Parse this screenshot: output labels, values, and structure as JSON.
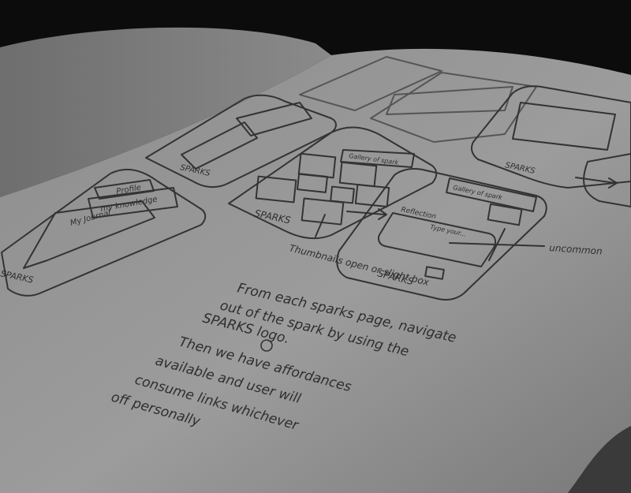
{
  "photo": {
    "subject": "sketchbook",
    "colors": {
      "background": "#0c0c0c",
      "page": "#9a9a9a",
      "left_page": "#8a8a8a",
      "ink": "#2e2e2e"
    }
  },
  "sketches": {
    "screen_left": {
      "header_1": "Profile",
      "header_2": "my knowledge",
      "box_label": "My Journal",
      "logo": "SPARKS"
    },
    "screen_middle": {
      "header": "Gallery of spark",
      "logo": "SPARKS"
    },
    "screen_right": {
      "header": "Gallery of spark",
      "box_title": "Reflection",
      "box_placeholder": "Type your...",
      "logo": "SPARKS"
    },
    "screen_top_middle": {
      "logo": "SPARKS"
    },
    "screen_top_right": {
      "logo": "SPARKS"
    },
    "annotation_thumbnails": "Thumbnails open or slight box",
    "annotation_right": "uncommon",
    "paragraph_lines": [
      "From each sparks page, navigate",
      "out of the spark by using the",
      "SPARKS logo.",
      "Then we have affordances",
      "available and user will",
      "consume links whichever",
      "off personally"
    ]
  }
}
